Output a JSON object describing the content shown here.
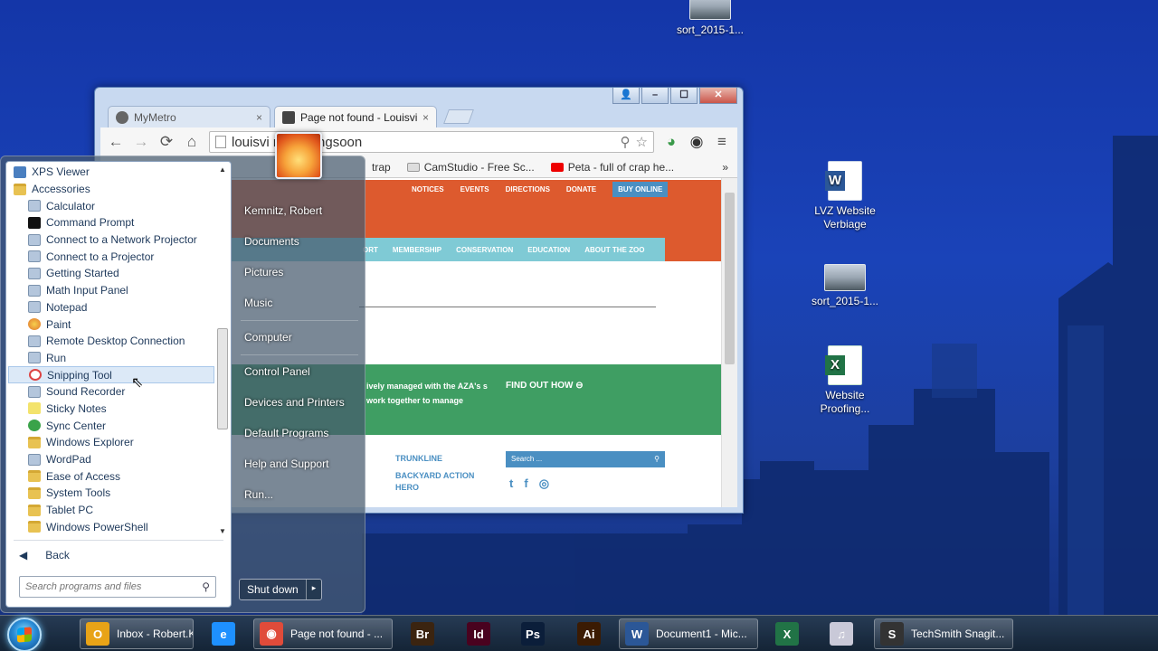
{
  "desktop": {
    "icons": [
      {
        "label": "sort_2015-1...",
        "icon": "video-thumbnail-icon"
      },
      {
        "label": "LVZ Website Verbiage",
        "icon": "word-document-icon"
      },
      {
        "label": "sort_2015-1...",
        "icon": "video-thumbnail-icon"
      },
      {
        "label": "Website Proofing...",
        "icon": "excel-document-icon"
      }
    ]
  },
  "browser": {
    "tabs": [
      {
        "label": "MyMetro",
        "close": "×",
        "active": false
      },
      {
        "label": "Page not found - Louisvill",
        "close": "×",
        "active": true
      }
    ],
    "window_buttons": {
      "user": "👤",
      "minimize": "–",
      "maximize": "☐",
      "close": "✕"
    },
    "nav": {
      "back": "←",
      "forward": "→",
      "reload": "⟳",
      "home": "⌂"
    },
    "address": "louisvi            rg/comingsoon",
    "bookmarks": [
      {
        "label": "trap"
      },
      {
        "label": "CamStudio - Free Sc..."
      },
      {
        "label": "Peta - full of crap he..."
      }
    ],
    "bookmarks_more": "»",
    "page": {
      "top_nav": [
        "NOTICES",
        "EVENTS",
        "DIRECTIONS",
        "DONATE",
        "BUY ONLINE"
      ],
      "sub_nav": [
        "ORT",
        "MEMBERSHIP",
        "CONSERVATION",
        "EDUCATION",
        "ABOUT THE ZOO"
      ],
      "green_text": "ively managed with the AZA's s work together to manage",
      "green_cta": "FIND OUT HOW ⊖",
      "footer_links": [
        "TRUNKLINE",
        "BACKYARD ACTION HERO"
      ],
      "search_placeholder": "Search ...",
      "social": [
        "t",
        "f",
        "◎"
      ]
    }
  },
  "start_menu": {
    "programs": [
      {
        "label": "XPS Viewer",
        "level": 0,
        "icon": "xps"
      },
      {
        "label": "Accessories",
        "level": 0,
        "icon": "folder"
      },
      {
        "label": "Calculator",
        "level": 1,
        "icon": "app"
      },
      {
        "label": "Command Prompt",
        "level": 1,
        "icon": "cmd"
      },
      {
        "label": "Connect to a Network Projector",
        "level": 1,
        "icon": "app"
      },
      {
        "label": "Connect to a Projector",
        "level": 1,
        "icon": "app"
      },
      {
        "label": "Getting Started",
        "level": 1,
        "icon": "app"
      },
      {
        "label": "Math Input Panel",
        "level": 1,
        "icon": "app"
      },
      {
        "label": "Notepad",
        "level": 1,
        "icon": "app"
      },
      {
        "label": "Paint",
        "level": 1,
        "icon": "paint"
      },
      {
        "label": "Remote Desktop Connection",
        "level": 1,
        "icon": "app"
      },
      {
        "label": "Run",
        "level": 1,
        "icon": "app"
      },
      {
        "label": "Snipping Tool",
        "level": 1,
        "icon": "snip",
        "highlighted": true
      },
      {
        "label": "Sound Recorder",
        "level": 1,
        "icon": "app"
      },
      {
        "label": "Sticky Notes",
        "level": 1,
        "icon": "sticky"
      },
      {
        "label": "Sync Center",
        "level": 1,
        "icon": "sync"
      },
      {
        "label": "Windows Explorer",
        "level": 1,
        "icon": "folder"
      },
      {
        "label": "WordPad",
        "level": 1,
        "icon": "app"
      },
      {
        "label": "Ease of Access",
        "level": 1,
        "icon": "folder"
      },
      {
        "label": "System Tools",
        "level": 1,
        "icon": "folder"
      },
      {
        "label": "Tablet PC",
        "level": 1,
        "icon": "folder"
      },
      {
        "label": "Windows PowerShell",
        "level": 1,
        "icon": "folder"
      }
    ],
    "back_label": "Back",
    "search_placeholder": "Search programs and files",
    "right_items": [
      "Kemnitz, Robert",
      "Documents",
      "Pictures",
      "Music",
      "Computer",
      "Control Panel",
      "Devices and Printers",
      "Default Programs",
      "Help and Support",
      "Run..."
    ],
    "shutdown_label": "Shut down",
    "shutdown_arrow": "▸"
  },
  "taskbar": {
    "items": [
      {
        "label": "Inbox - Robert.Ke...",
        "icon": "outlook-icon",
        "glyph": "O",
        "color": "#e8a317"
      },
      {
        "label": "",
        "icon": "internet-explorer-icon",
        "glyph": "e",
        "color": "#1e90ff"
      },
      {
        "label": "Page not found - ...",
        "icon": "chrome-icon",
        "glyph": "◉",
        "color": "#e04b3a"
      },
      {
        "label": "",
        "icon": "bridge-icon",
        "glyph": "Br",
        "color": "#3b2410"
      },
      {
        "label": "",
        "icon": "indesign-icon",
        "glyph": "Id",
        "color": "#49021f"
      },
      {
        "label": "",
        "icon": "photoshop-icon",
        "glyph": "Ps",
        "color": "#0b1e3a"
      },
      {
        "label": "",
        "icon": "illustrator-icon",
        "glyph": "Ai",
        "color": "#3b1b03"
      },
      {
        "label": "Document1 - Mic...",
        "icon": "word-icon",
        "glyph": "W",
        "color": "#2b5797"
      },
      {
        "label": "",
        "icon": "excel-icon",
        "glyph": "X",
        "color": "#217346"
      },
      {
        "label": "",
        "icon": "itunes-icon",
        "glyph": "♫",
        "color": "#c9c9d8"
      },
      {
        "label": "TechSmith Snagit...",
        "icon": "snagit-icon",
        "glyph": "S",
        "color": "#333333"
      }
    ]
  }
}
